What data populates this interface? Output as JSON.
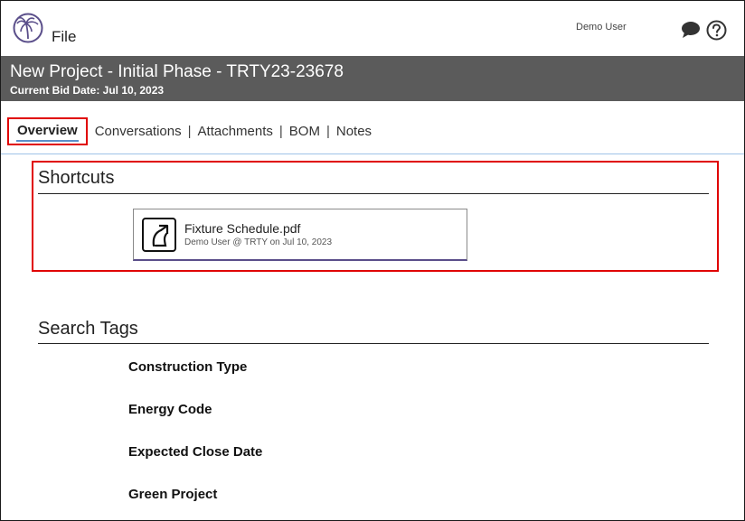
{
  "header": {
    "app_title": "File",
    "user_name": "Demo User",
    "icons": [
      "palm-tree-logo-icon",
      "chat-bubble-icon",
      "help-circle-icon"
    ],
    "brand_color": "#5a4e8a"
  },
  "project": {
    "title": "New Project - Initial Phase - TRTY23-23678",
    "bid_date": "Current Bid Date: Jul 10, 2023",
    "bar_color": "#5b5b5b"
  },
  "tabs": {
    "items": [
      {
        "label": "Overview",
        "active": true
      },
      {
        "label": "Conversations",
        "active": false
      },
      {
        "label": "Attachments",
        "active": false
      },
      {
        "label": "BOM",
        "active": false
      },
      {
        "label": "Notes",
        "active": false
      }
    ],
    "separator": "|"
  },
  "shortcuts": {
    "title": "Shortcuts",
    "items": [
      {
        "name": "Fixture Schedule.pdf",
        "meta": "Demo User @ TRTY on Jul 10, 2023",
        "icon": "shortcut-arrow-icon"
      }
    ]
  },
  "search_tags": {
    "title": "Search Tags",
    "labels": [
      "Construction Type",
      "Energy Code",
      "Expected Close Date",
      "Green Project"
    ]
  },
  "highlight_color": "#e00000"
}
